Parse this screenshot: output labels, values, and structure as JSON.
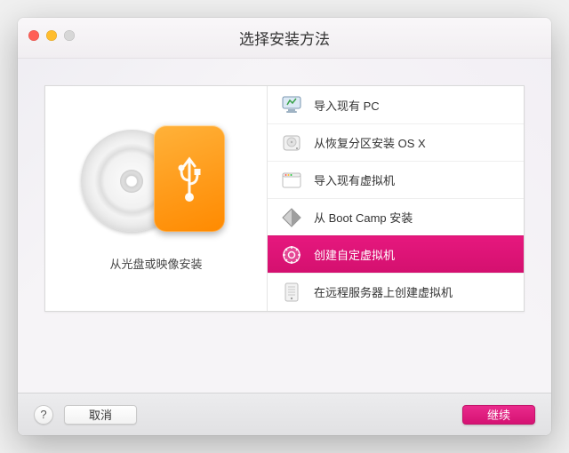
{
  "window": {
    "title": "选择安装方法"
  },
  "left": {
    "label": "从光盘或映像安装"
  },
  "options": [
    {
      "key": "import-pc",
      "label": "导入现有 PC",
      "icon": "monitor-icon",
      "selected": false
    },
    {
      "key": "recovery-osx",
      "label": "从恢复分区安装 OS X",
      "icon": "hdd-icon",
      "selected": false
    },
    {
      "key": "import-vm",
      "label": "导入现有虚拟机",
      "icon": "window-icon",
      "selected": false
    },
    {
      "key": "bootcamp",
      "label": "从 Boot Camp 安装",
      "icon": "partition-icon",
      "selected": false
    },
    {
      "key": "custom-vm",
      "label": "创建自定虚拟机",
      "icon": "gear-icon",
      "selected": true
    },
    {
      "key": "remote-vm",
      "label": "在远程服务器上创建虚拟机",
      "icon": "server-icon",
      "selected": false
    }
  ],
  "footer": {
    "help": "?",
    "cancel": "取消",
    "continue": "继续"
  },
  "colors": {
    "accent": "#e01a7c"
  }
}
